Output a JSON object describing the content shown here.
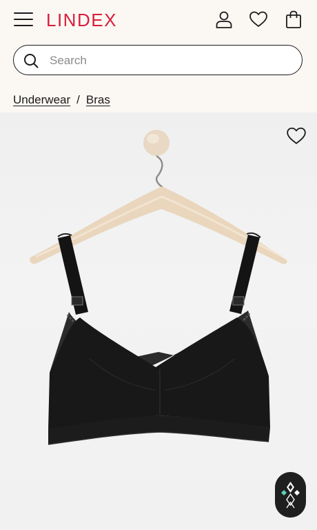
{
  "brand": {
    "logo_text": "LINDEX",
    "color": "#d81e3c"
  },
  "header": {
    "menu_icon": "hamburger-menu-icon",
    "account_icon": "user-icon",
    "wishlist_icon": "heart-icon",
    "bag_icon": "shopping-bag-icon"
  },
  "search": {
    "placeholder": "Search",
    "value": ""
  },
  "breadcrumb": {
    "items": [
      {
        "label": "Underwear"
      },
      {
        "label": "Bras"
      }
    ],
    "separator": "/"
  },
  "product": {
    "wishlist_icon": "heart-outline-icon",
    "image": "black-nursing-bra-on-wooden-hanger"
  },
  "chat": {
    "icon": "chat-assistant-icon"
  }
}
